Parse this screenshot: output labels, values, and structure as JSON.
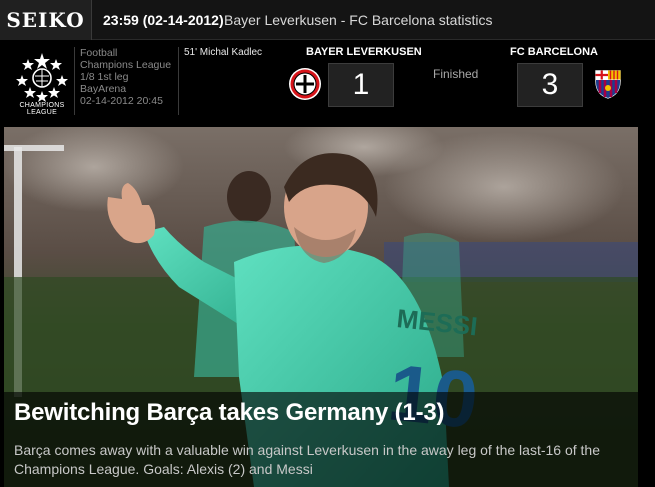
{
  "topbar": {
    "brand": "SEIKO",
    "time": "23:59 (02-14-2012)",
    "title": "Bayer Leverkusen - FC Barcelona statistics"
  },
  "competition": {
    "logo_text": "CHAMPIONS LEAGUE",
    "sport": "Football",
    "name": "Champions League",
    "round": "1/8 1st leg",
    "venue": "BayArena",
    "datetime": "02-14-2012 20:45"
  },
  "event": "51' Michal Kadlec",
  "match": {
    "home": {
      "name": "BAYER LEVERKUSEN",
      "score": "1",
      "crest": "leverkusen-crest-icon"
    },
    "away": {
      "name": "FC BARCELONA",
      "score": "3",
      "crest": "barcelona-crest-icon"
    },
    "status": "Finished"
  },
  "article": {
    "headline": "Bewitching Barça takes Germany (1-3)",
    "summary": "Barça comes away with a valuable win against Leverkusen in the away leg of the last-16 of the Champions League. Goals: Alexis (2) and Messi",
    "shirt_name": "MESSI",
    "shirt_number": "10"
  },
  "colors": {
    "leverkusen_red": "#d7141a",
    "barca_blue": "#1b3f8f",
    "barca_garnet": "#a50044",
    "kit_turquoise": "#3fc8a8"
  }
}
